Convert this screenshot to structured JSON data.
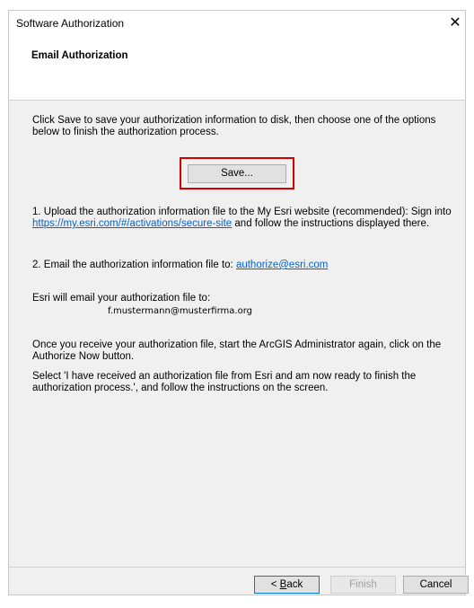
{
  "window": {
    "title": "Software Authorization",
    "close_glyph": "✕"
  },
  "header": {
    "title": "Email Authorization"
  },
  "content": {
    "intro": "Click Save to save your authorization information to disk, then choose one of the options below to finish the authorization process.",
    "save_label": "Save...",
    "step1_text": "1.  Upload the authorization information file to the My Esri website (recommended): Sign into",
    "step1_link": "https://my.esri.com/#/activations/secure-site",
    "step1_suffix": " and follow the instructions displayed there.",
    "step2_text": "2.  Email the authorization information file to: ",
    "step2_link": "authorize@esri.com",
    "esri_email_text": "Esri will email your authorization file to:",
    "recipient_email": "f.mustermann@musterfirma.org",
    "once_text": "Once you receive your authorization file, start the ArcGIS Administrator again, click on the Authorize Now button.",
    "select_text": "Select 'I have received an authorization file from Esri and am now ready to finish the authorization process.', and follow the instructions on the screen."
  },
  "footer": {
    "back_prefix": "< ",
    "back_underlined": "B",
    "back_rest": "ack",
    "finish_label": "Finish",
    "cancel_label": "Cancel"
  }
}
